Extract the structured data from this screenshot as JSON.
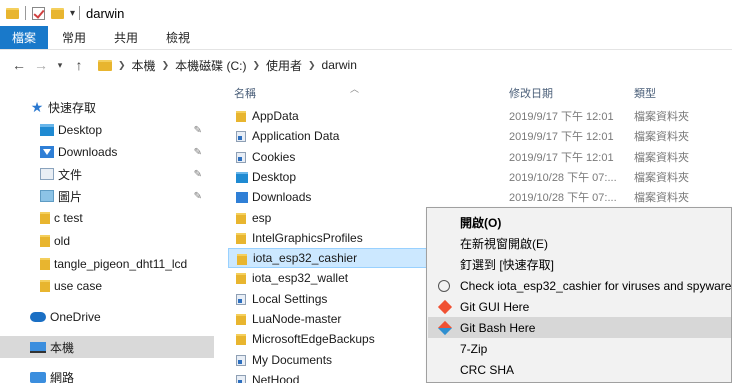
{
  "window": {
    "title": "darwin"
  },
  "ribbon": {
    "tabs": [
      "檔案",
      "常用",
      "共用",
      "檢視"
    ]
  },
  "address": {
    "path": [
      "本機",
      "本機磁碟 (C:)",
      "使用者",
      "darwin"
    ]
  },
  "nav": {
    "quick_access": "快速存取",
    "items": [
      {
        "label": "Desktop",
        "icon": "desktop-folder-icon",
        "pinned": true
      },
      {
        "label": "Downloads",
        "icon": "downloads-folder-icon",
        "pinned": true
      },
      {
        "label": "文件",
        "icon": "documents-folder-icon",
        "pinned": true
      },
      {
        "label": "圖片",
        "icon": "pictures-folder-icon",
        "pinned": true
      },
      {
        "label": "c test",
        "icon": "folder-icon",
        "pinned": false
      },
      {
        "label": "old",
        "icon": "folder-icon",
        "pinned": false
      },
      {
        "label": "tangle_pigeon_dht11_lcd",
        "icon": "folder-icon",
        "pinned": false
      },
      {
        "label": "use case",
        "icon": "folder-icon",
        "pinned": false
      }
    ],
    "onedrive": "OneDrive",
    "this_pc": "本機",
    "network": "網路"
  },
  "list": {
    "headers": {
      "name": "名稱",
      "date": "修改日期",
      "type": "類型"
    },
    "rows": [
      {
        "name": "AppData",
        "date": "2019/9/17 下午 12:01",
        "type": "檔案資料夾",
        "icon": "folder"
      },
      {
        "name": "Application Data",
        "date": "2019/9/17 下午 12:01",
        "type": "檔案資料夾",
        "icon": "link"
      },
      {
        "name": "Cookies",
        "date": "2019/9/17 下午 12:01",
        "type": "檔案資料夾",
        "icon": "link"
      },
      {
        "name": "Desktop",
        "date": "2019/10/28 下午 07:...",
        "type": "檔案資料夾",
        "icon": "desktop"
      },
      {
        "name": "Downloads",
        "date": "2019/10/28 下午 07:...",
        "type": "檔案資料夾",
        "icon": "downloads"
      },
      {
        "name": "esp",
        "date": "",
        "type": "",
        "icon": "folder"
      },
      {
        "name": "IntelGraphicsProfiles",
        "date": "",
        "type": "",
        "icon": "folder"
      },
      {
        "name": "iota_esp32_cashier",
        "date": "",
        "type": "",
        "icon": "folder",
        "selected": true
      },
      {
        "name": "iota_esp32_wallet",
        "date": "",
        "type": "",
        "icon": "folder"
      },
      {
        "name": "Local Settings",
        "date": "",
        "type": "",
        "icon": "link"
      },
      {
        "name": "LuaNode-master",
        "date": "",
        "type": "",
        "icon": "folder"
      },
      {
        "name": "MicrosoftEdgeBackups",
        "date": "",
        "type": "",
        "icon": "folder"
      },
      {
        "name": "My Documents",
        "date": "",
        "type": "",
        "icon": "link"
      },
      {
        "name": "NetHood",
        "date": "",
        "type": "",
        "icon": "link"
      }
    ]
  },
  "context_menu": {
    "items": [
      {
        "label": "開啟(O)",
        "bold": true
      },
      {
        "label": "在新視窗開啟(E)"
      },
      {
        "label": "釘選到 [快速存取]"
      },
      {
        "label": "Check iota_esp32_cashier for viruses and spyware",
        "icon": "virus-scan-icon"
      },
      {
        "label": "Git GUI Here",
        "icon": "git-gui-icon"
      },
      {
        "label": "Git Bash Here",
        "icon": "git-bash-icon",
        "hover": true
      },
      {
        "label": "7-Zip"
      },
      {
        "label": "CRC SHA"
      }
    ]
  }
}
